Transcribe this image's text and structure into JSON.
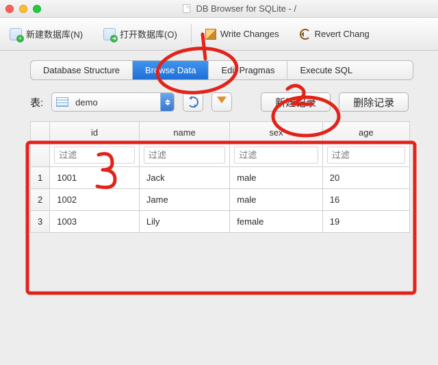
{
  "window": {
    "title": "DB Browser for SQLite - /"
  },
  "toolbar": {
    "new_db": "新建数据库(N)",
    "open_db": "打开数据库(O)",
    "write_changes": "Write Changes",
    "revert_changes": "Revert Chang"
  },
  "tabs": {
    "structure": "Database Structure",
    "browse": "Browse Data",
    "pragmas": "Edit Pragmas",
    "execute": "Execute SQL"
  },
  "browse": {
    "table_label": "表:",
    "table_selected": "demo",
    "new_record": "新建记录",
    "delete_record": "删除记录",
    "filter_placeholder": "过滤",
    "columns": {
      "id": "id",
      "name": "name",
      "sex": "sex",
      "age": "age"
    },
    "rows": [
      {
        "n": "1",
        "id": "1001",
        "name": "Jack",
        "sex": "male",
        "age": "20"
      },
      {
        "n": "2",
        "id": "1002",
        "name": "Jame",
        "sex": "male",
        "age": "16"
      },
      {
        "n": "3",
        "id": "1003",
        "name": "Lily",
        "sex": "female",
        "age": "19"
      }
    ]
  },
  "annotation": {
    "marks": [
      "circle-browse-data",
      "circle-new-record",
      "box-table",
      "digit-1",
      "digit-2",
      "digit-3"
    ]
  }
}
